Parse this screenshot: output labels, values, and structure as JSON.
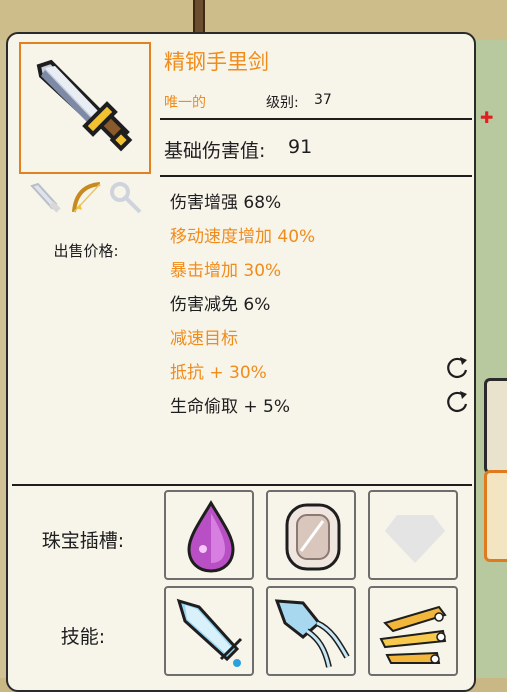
{
  "item": {
    "name": "精钢手里剑",
    "rarity": "唯一的",
    "level_label": "级别:",
    "level_value": "37",
    "base_damage_label": "基础伤害值:",
    "base_damage_value": "91"
  },
  "sell": {
    "label": "出售价格:"
  },
  "stats": [
    {
      "text": "伤害增强 68%",
      "color": "#1e1e1e"
    },
    {
      "text": "移动速度增加 40%",
      "color": "#f08c1c"
    },
    {
      "text": "暴击增加 30%",
      "color": "#f08c1c"
    },
    {
      "text": "伤害减免 6%",
      "color": "#1e1e1e"
    },
    {
      "text": "减速目标",
      "color": "#f08c1c"
    },
    {
      "text": "抵抗 + 30%",
      "color": "#f08c1c"
    },
    {
      "text": "生命偷取 + 5%",
      "color": "#1e1e1e"
    }
  ],
  "gems": {
    "label": "珠宝插槽:",
    "slots": [
      "pink-teardrop-gem-icon",
      "white-cut-gem-icon",
      "empty-gem-slot-icon"
    ]
  },
  "skills": {
    "label": "技能:",
    "slots": [
      "ice-arrow-skill-icon",
      "frost-squid-skill-icon",
      "golden-blades-skill-icon"
    ]
  },
  "colors": {
    "accent": "#f08c1c",
    "panel": "#f7f4ea",
    "border": "#2a2a2a"
  }
}
